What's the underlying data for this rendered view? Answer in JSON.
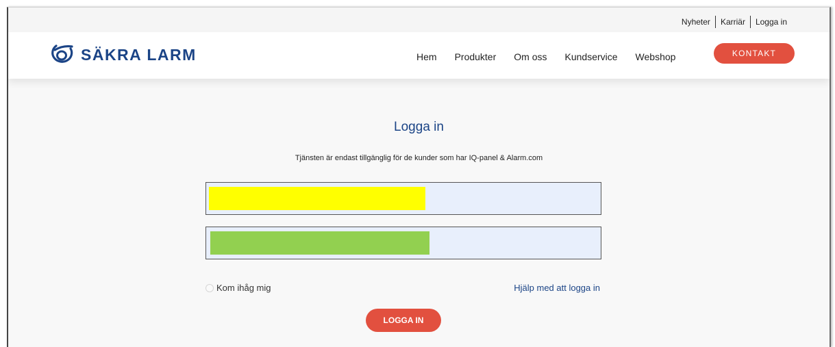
{
  "top_links": [
    {
      "label": "Nyheter"
    },
    {
      "label": "Karriär"
    },
    {
      "label": "Logga in"
    }
  ],
  "brand": {
    "name": "SÄKRA LARM",
    "color": "#1b4486"
  },
  "nav": [
    {
      "label": "Hem"
    },
    {
      "label": "Produkter"
    },
    {
      "label": "Om oss"
    },
    {
      "label": "Kundservice"
    },
    {
      "label": "Webshop"
    }
  ],
  "contact_button": {
    "label": "KONTAKT",
    "color": "#e2503f"
  },
  "login": {
    "title": "Logga in",
    "subtitle": "Tjänsten är endast tillgänglig för de kunder som har IQ-panel & Alarm.com",
    "username_field": {
      "value": "",
      "highlight_color": "#ffff00"
    },
    "password_field": {
      "value": "",
      "highlight_color": "#92d050"
    },
    "remember_label": "Kom ihåg mig",
    "help_link": "Hjälp med att logga in",
    "submit_label": "LOGGA IN"
  }
}
